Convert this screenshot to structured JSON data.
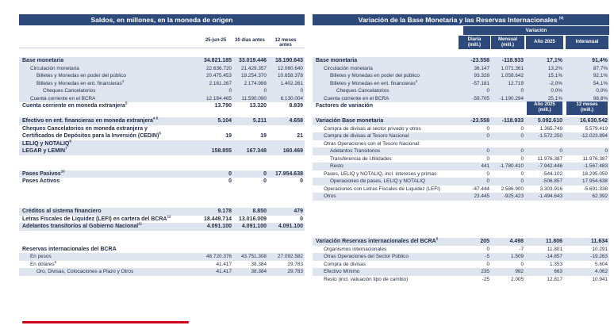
{
  "left": {
    "title": "Saldos, en millones, en la moneda de origen",
    "columns": [
      "25-jun-25",
      "30 días antes",
      "12 meses antes"
    ],
    "rows": [
      {
        "label": "Base monetaria",
        "sup": "",
        "v": [
          "34.821.185",
          "33.019.446",
          "18.190.643"
        ],
        "style": "bold shade",
        "indent": 0
      },
      {
        "label": "Circulación monetaria",
        "sup": "",
        "v": [
          "22.636.720",
          "21.429.357",
          "12.060.640"
        ],
        "style": "shade",
        "indent": 1
      },
      {
        "label": "Billetes y Monedas en poder del público",
        "sup": "",
        "v": [
          "20.475.453",
          "19.254.370",
          "10.658.378"
        ],
        "style": "shade",
        "indent": 2
      },
      {
        "label": "Billetes y Monedas en ent. financieras",
        "sup": "4",
        "v": [
          "2.161.267",
          "2.174.986",
          "1.402.261"
        ],
        "style": "shade",
        "indent": 2
      },
      {
        "label": "Cheques Cancelatorios",
        "sup": "",
        "v": [
          "0",
          "0",
          "0"
        ],
        "style": "shade",
        "indent": 3
      },
      {
        "label": "Cuenta corriente en el BCRA",
        "sup": "",
        "v": [
          "12.184.465",
          "11.590.090",
          "6.130.004"
        ],
        "style": "shade",
        "indent": 1
      },
      {
        "label": "Cuenta corriente en moneda extranjera",
        "sup": "5",
        "v": [
          "13.790",
          "13.320",
          "8.839"
        ],
        "style": "bold",
        "indent": 0
      },
      {
        "label": "",
        "sup": "",
        "v": [
          "",
          "",
          ""
        ],
        "style": "gap",
        "indent": 0
      },
      {
        "label": "Efectivo en ent. financieras en moneda extranjera",
        "sup": "4 5",
        "v": [
          "5.104",
          "5.211",
          "4.658"
        ],
        "style": "bold shade",
        "indent": 0
      },
      {
        "label": "Cheques Cancelatorios en moneda extranjera y",
        "sup": "",
        "v": [
          "",
          "",
          ""
        ],
        "style": "bold",
        "indent": 0
      },
      {
        "label": "Certificados de Depósitos para la Inversión (CEDIN)",
        "sup": "5",
        "v": [
          "19",
          "19",
          "21"
        ],
        "style": "bold",
        "indent": 0
      },
      {
        "label": "LELIQ y NOTALIQ",
        "sup": "6",
        "v": [
          "",
          "",
          ""
        ],
        "style": "bold shade",
        "indent": 0
      },
      {
        "label": "LEGAR y LEMIN",
        "sup": "7",
        "v": [
          "158.855",
          "167.348",
          "160.469"
        ],
        "style": "bold shade",
        "indent": 0
      },
      {
        "label": "",
        "sup": "",
        "v": [
          "",
          "",
          ""
        ],
        "style": "gap",
        "indent": 0
      },
      {
        "label": "",
        "sup": "",
        "v": [
          "",
          "",
          ""
        ],
        "style": "gap",
        "indent": 0
      },
      {
        "label": "Pases Pasivos",
        "sup": "10",
        "v": [
          "0",
          "0",
          "17.954.638"
        ],
        "style": "bold shade",
        "indent": 0
      },
      {
        "label": "Pases Activos",
        "sup": "",
        "v": [
          "0",
          "0",
          "0"
        ],
        "style": "bold",
        "indent": 0
      },
      {
        "label": "",
        "sup": "",
        "v": [
          "",
          "",
          ""
        ],
        "style": "gap",
        "indent": 0
      },
      {
        "label": "",
        "sup": "",
        "v": [
          "",
          "",
          ""
        ],
        "style": "gap",
        "indent": 0
      },
      {
        "label": "",
        "sup": "",
        "v": [
          "",
          "",
          ""
        ],
        "style": "gap",
        "indent": 0
      },
      {
        "label": "Créditos al sistema financiero",
        "sup": "",
        "v": [
          "9.178",
          "8.850",
          "479"
        ],
        "style": "bold shade",
        "indent": 0
      },
      {
        "label": "Letras Fiscales de Liquidez (LEFI) en cartera del BCRA",
        "sup": "12",
        "v": [
          "18.449.714",
          "13.016.009",
          "0"
        ],
        "style": "bold",
        "indent": 0
      },
      {
        "label": "Adelantos transitorios al Gobierno Nacional",
        "sup": "11",
        "v": [
          "4.091.100",
          "4.091.100",
          "4.091.100"
        ],
        "style": "bold shade",
        "indent": 0
      },
      {
        "label": "",
        "sup": "",
        "v": [
          "",
          "",
          ""
        ],
        "style": "gap",
        "indent": 0
      },
      {
        "label": "",
        "sup": "",
        "v": [
          "",
          "",
          ""
        ],
        "style": "gap",
        "indent": 0
      },
      {
        "label": "Reservas internacionales del BCRA",
        "sup": "",
        "v": [
          "",
          "",
          ""
        ],
        "style": "bold",
        "indent": 0
      },
      {
        "label": "En pesos",
        "sup": "",
        "v": [
          "48.720.376",
          "43.751.308",
          "27.092.582"
        ],
        "style": "shade",
        "indent": 1
      },
      {
        "label": "En dólares",
        "sup": "5",
        "v": [
          "41.417",
          "38.384",
          "29.783"
        ],
        "style": "",
        "indent": 1
      },
      {
        "label": "Oro, Divisas, Colocaciones a Plazo y Otros",
        "sup": "",
        "v": [
          "41.417",
          "38.384",
          "29.783"
        ],
        "style": "shade",
        "indent": 2
      }
    ]
  },
  "right": {
    "title": "Variación de la Base Monetaria y las Reservas Internacionales",
    "title_sup": "(9)",
    "group_label": "Variación",
    "columns": [
      "Diaria\n(mill.)",
      "Mensual\n(mill.)",
      "Año 2025",
      "Interanual"
    ],
    "rows": [
      {
        "label": "Base monetaria",
        "sup": "",
        "v": [
          "-23.558",
          "-118.933",
          "17,1%",
          "91,4%"
        ],
        "style": "bold shade",
        "indent": 0
      },
      {
        "label": "Circulación monetaria",
        "sup": "",
        "v": [
          "36.147",
          "1.071.361",
          "13,2%",
          "87,7%"
        ],
        "style": "shade",
        "indent": 1
      },
      {
        "label": "Billetes y Monedas en poder del público",
        "sup": "",
        "v": [
          "93.328",
          "1.058.642",
          "15,1%",
          "92,1%"
        ],
        "style": "shade",
        "indent": 2
      },
      {
        "label": "Billetes y Monedas en ent. financieras",
        "sup": "4",
        "v": [
          "-57.181",
          "12.719",
          "-2,0%",
          "54,1%"
        ],
        "style": "shade",
        "indent": 2
      },
      {
        "label": "Cheques Cancelatorios",
        "sup": "",
        "v": [
          "0",
          "0",
          "0,0%",
          "0,0%"
        ],
        "style": "shade",
        "indent": 3
      },
      {
        "label": "Cuenta corriente en el BCRA",
        "sup": "",
        "v": [
          "-59.705",
          "-1.190.294",
          "25,1%",
          "98,8%"
        ],
        "style": "shade",
        "indent": 1
      },
      {
        "label": "Factores de variación",
        "sup": "",
        "v": [
          "",
          "",
          "Año 2025\n(mill.)",
          "12 meses\n(mill.)"
        ],
        "style": "bold header",
        "indent": 0
      },
      {
        "label": "",
        "sup": "",
        "v": [
          "",
          "",
          "",
          ""
        ],
        "style": "gap",
        "indent": 0
      },
      {
        "label": "Variación Base monetaria",
        "sup": "",
        "v": [
          "-23.558",
          "-118.933",
          "5.092.610",
          "16.630.542"
        ],
        "style": "bold shade",
        "indent": 0
      },
      {
        "label": "Compra de divisas al sector privado y otros",
        "sup": "",
        "v": [
          "0",
          "0",
          "1.365.749",
          "5.579.419"
        ],
        "style": "",
        "indent": 1
      },
      {
        "label": "Compra de divisas al Tesoro Nacional",
        "sup": "",
        "v": [
          "0",
          "0",
          "-1.572.250",
          "-12.023.894"
        ],
        "style": "shade",
        "indent": 1
      },
      {
        "label": "Otras Operaciones con el Tesoro Nacional:",
        "sup": "",
        "v": [
          "",
          "",
          "",
          ""
        ],
        "style": "",
        "indent": 1
      },
      {
        "label": "Adelantos Transitorios",
        "sup": "",
        "v": [
          "0",
          "0",
          "0",
          "0"
        ],
        "style": "shade",
        "indent": 2
      },
      {
        "label": "Transferencia de Utilidades",
        "sup": "",
        "v": [
          "0",
          "0",
          "11.976.387",
          "11.976.387"
        ],
        "style": "",
        "indent": 2
      },
      {
        "label": "Resto",
        "sup": "",
        "v": [
          "441",
          "-1.780.410",
          "-7.942.446",
          "-1.567.483"
        ],
        "style": "shade",
        "indent": 2
      },
      {
        "label": "Pases, LELIQ y NOTALIQ, incl. intereses y primas",
        "sup": "",
        "v": [
          "0",
          "0",
          "-544.102",
          "18.295.059"
        ],
        "style": "",
        "indent": 1
      },
      {
        "label": "Operaciones de pases, LELIQ y NOTALIQ",
        "sup": "",
        "v": [
          "0",
          "0",
          "-506.857",
          "17.954.638"
        ],
        "style": "shade",
        "indent": 2
      },
      {
        "label": "Operaciones con Letras Fiscales de Liquidez (LEFI)",
        "sup": "",
        "v": [
          "-47.444",
          "2.586.900",
          "3.303.916",
          "-5.691.338"
        ],
        "style": "",
        "indent": 1
      },
      {
        "label": "Otros",
        "sup": "",
        "v": [
          "23.445",
          "-925.423",
          "-1.494.643",
          "62.392"
        ],
        "style": "shade",
        "indent": 1
      },
      {
        "label": "",
        "sup": "",
        "v": [
          "",
          "",
          "",
          ""
        ],
        "style": "gap",
        "indent": 0
      },
      {
        "label": "",
        "sup": "",
        "v": [
          "",
          "",
          "",
          ""
        ],
        "style": "gap",
        "indent": 0
      },
      {
        "label": "",
        "sup": "",
        "v": [
          "",
          "",
          "",
          ""
        ],
        "style": "gap",
        "indent": 0
      },
      {
        "label": "",
        "sup": "",
        "v": [
          "",
          "",
          "",
          ""
        ],
        "style": "gap",
        "indent": 0
      },
      {
        "label": "",
        "sup": "",
        "v": [
          "",
          "",
          "",
          ""
        ],
        "style": "gap",
        "indent": 0
      },
      {
        "label": "Variación Reservas internacionales del BCRA",
        "sup": "5",
        "v": [
          "205",
          "4.498",
          "11.806",
          "11.634"
        ],
        "style": "bold shade",
        "indent": 0
      },
      {
        "label": "Organismos internacionales",
        "sup": "",
        "v": [
          "0",
          "-7",
          "11.801",
          "10.291"
        ],
        "style": "",
        "indent": 1
      },
      {
        "label": "Otras Operaciones del Sector Público",
        "sup": "",
        "v": [
          "-5",
          "1.509",
          "-14.857",
          "-19.263"
        ],
        "style": "shade",
        "indent": 1
      },
      {
        "label": "Compra de divisas",
        "sup": "",
        "v": [
          "0",
          "0",
          "1.353",
          "5.604"
        ],
        "style": "",
        "indent": 1
      },
      {
        "label": "Efectivo Mínimo",
        "sup": "",
        "v": [
          "235",
          "992",
          "663",
          "4.062"
        ],
        "style": "shade",
        "indent": 1
      },
      {
        "label": "Resto (incl. valuación tipo de cambio)",
        "sup": "",
        "v": [
          "-25",
          "2.005",
          "12.817",
          "10.941"
        ],
        "style": "",
        "indent": 1
      }
    ]
  }
}
